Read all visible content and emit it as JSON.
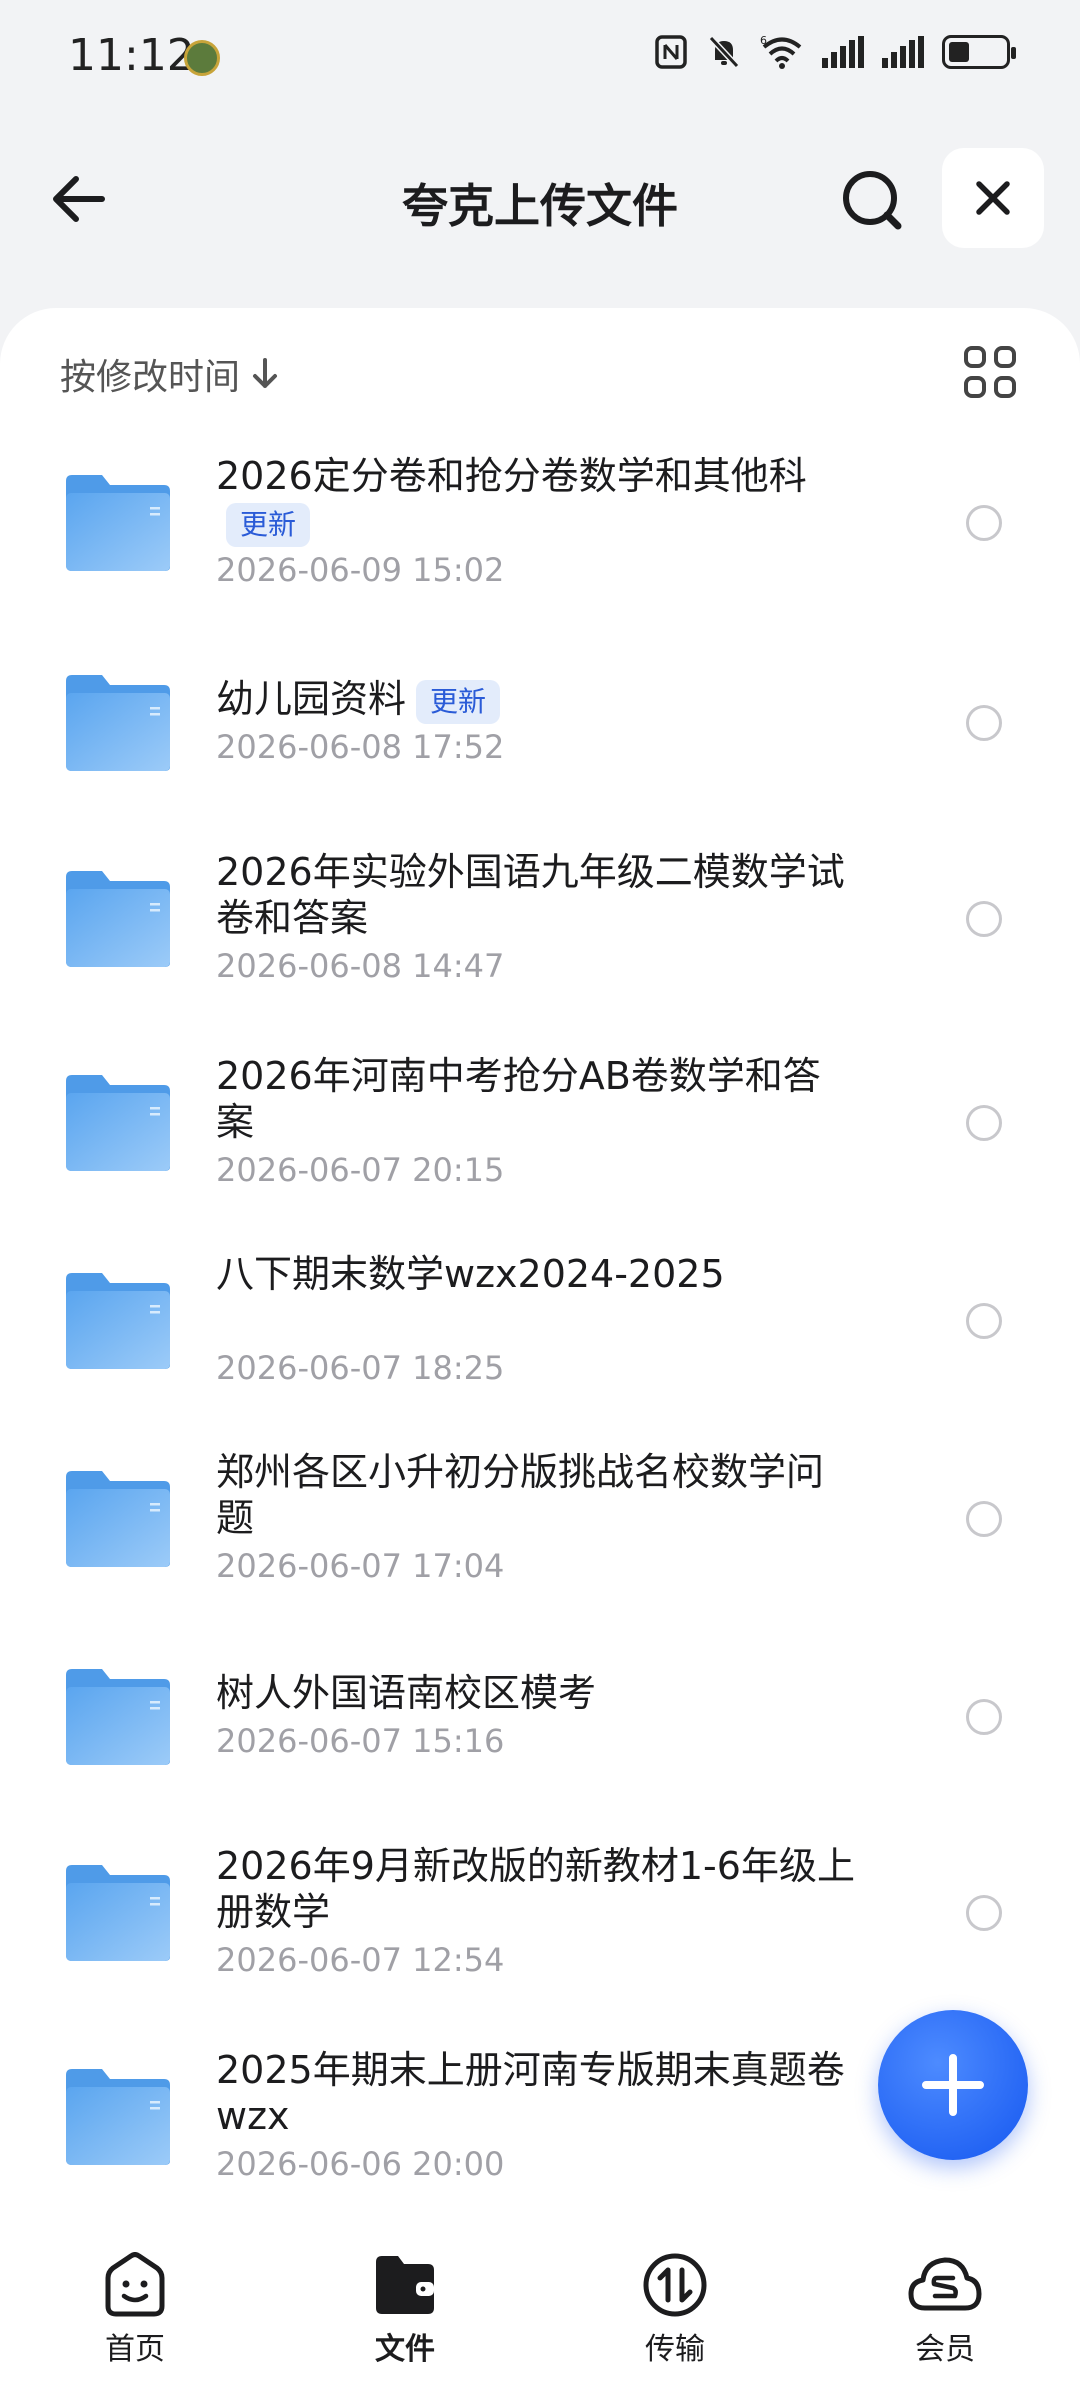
{
  "status_bar": {
    "time": "11:12",
    "wifi_tag": "6"
  },
  "header": {
    "title": "夸克上传文件"
  },
  "sort": {
    "label": "按修改时间"
  },
  "files": [
    {
      "name": "2026定分卷和抢分卷数学和其他科",
      "badge": "更新",
      "date": "2026-06-09 15:02"
    },
    {
      "name": "幼儿园资料",
      "badge": "更新",
      "date": "2026-06-08 17:52"
    },
    {
      "name": "2026年实验外国语九年级二模数学试卷和答案",
      "badge": "",
      "date": "2026-06-08 14:47"
    },
    {
      "name": "2026年河南中考抢分AB卷数学和答案",
      "badge": "",
      "date": "2026-06-07 20:15"
    },
    {
      "name": "八下期末数学wzx2024-2025",
      "badge": "",
      "date": "2026-06-07 18:25"
    },
    {
      "name": "郑州各区小升初分版挑战名校数学问题",
      "badge": "",
      "date": "2026-06-07 17:04"
    },
    {
      "name": "树人外国语南校区模考",
      "badge": "",
      "date": "2026-06-07 15:16"
    },
    {
      "name": "2026年9月新改版的新教材1-6年级上册数学",
      "badge": "",
      "date": "2026-06-07 12:54"
    },
    {
      "name": "2025年期末上册河南专版期末真题卷wzx",
      "badge": "",
      "date": "2026-06-06 20:00"
    }
  ],
  "nav": {
    "home": "首页",
    "files": "文件",
    "transfer": "传输",
    "member": "会员"
  },
  "colors": {
    "accent": "#1557f0",
    "badge_bg": "#e3ecfb",
    "folder": "#6cb0f2"
  }
}
